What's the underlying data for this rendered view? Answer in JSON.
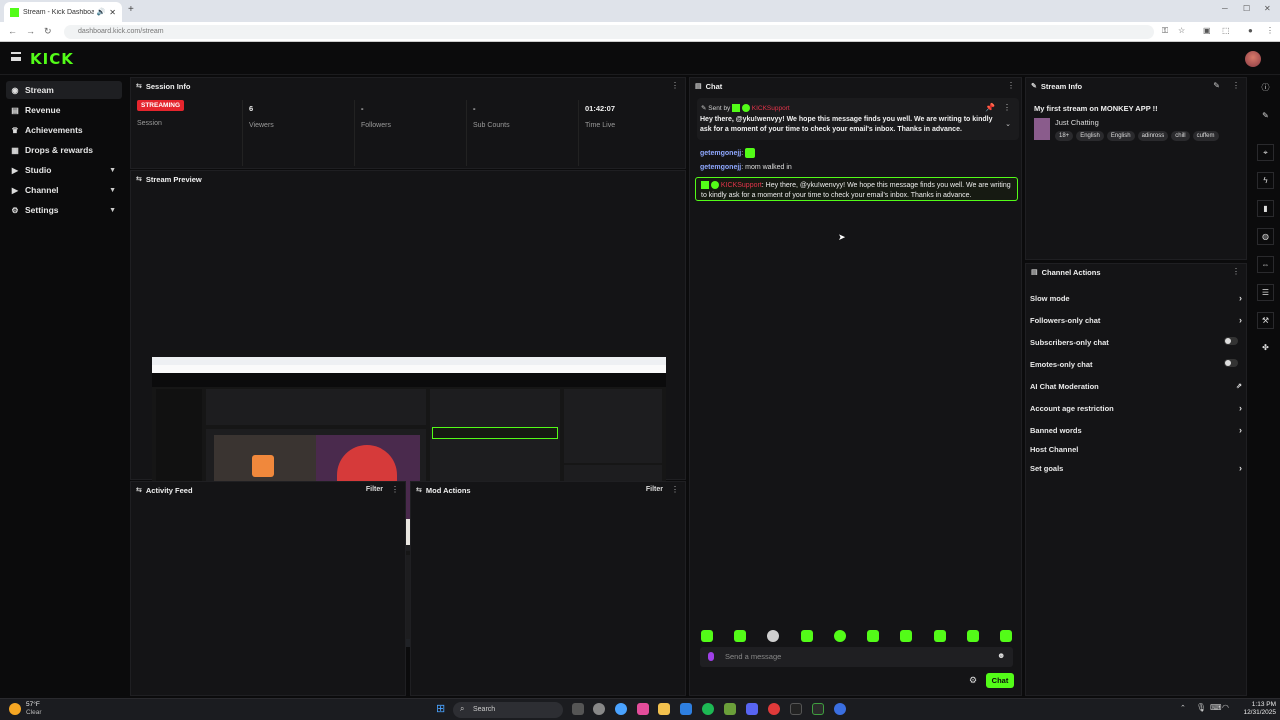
{
  "browser": {
    "tab_title": "Stream - Kick Dashboard",
    "url": "dashboard.kick.com/stream"
  },
  "app": {
    "logo": "KICK"
  },
  "sidebar": {
    "items": [
      {
        "label": "Stream",
        "icon": "broadcast-icon"
      },
      {
        "label": "Revenue",
        "icon": "revenue-icon"
      },
      {
        "label": "Achievements",
        "icon": "trophy-icon"
      },
      {
        "label": "Drops & rewards",
        "icon": "gift-icon"
      },
      {
        "label": "Studio",
        "icon": "studio-icon"
      },
      {
        "label": "Channel",
        "icon": "channel-icon"
      },
      {
        "label": "Settings",
        "icon": "gear-icon"
      }
    ]
  },
  "session_info": {
    "title": "Session Info",
    "status_badge": "STREAMING",
    "session_label": "Session",
    "viewers_value": "6",
    "viewers_label": "Viewers",
    "followers_value": "-",
    "followers_label": "Followers",
    "subs_value": "-",
    "subs_label": "Sub Counts",
    "time_value": "01:42:07",
    "time_label": "Time Live"
  },
  "stream_preview": {
    "title": "Stream Preview"
  },
  "activity_feed": {
    "title": "Activity Feed",
    "filter": "Filter"
  },
  "mod_actions": {
    "title": "Mod Actions",
    "filter": "Filter"
  },
  "chat": {
    "title": "Chat",
    "pinned_header": "Sent by",
    "pinned_user": "KICKSupport",
    "pinned_text": "Hey there, @yku!wenvyy! We hope this message finds you well. We are writing to kindly ask for a moment of your time to check your email's inbox. Thanks in advance.",
    "messages": [
      {
        "user": "getemgonejj",
        "text": ""
      },
      {
        "user": "getemgonejj",
        "text": "mom walked in"
      }
    ],
    "highlighted": {
      "user": "KICKSupport",
      "text": "Hey there, @yku!wenvyy! We hope this message finds you well. We are writing to kindly ask for a moment of your time to check your email's inbox. Thanks in advance."
    },
    "input_placeholder": "Send a message",
    "send_label": "Chat"
  },
  "stream_info": {
    "title": "Stream Info",
    "stream_title": "My first stream on MONKEY APP !!",
    "category": "Just Chatting",
    "tags": [
      "18+",
      "English",
      "English",
      "adinross",
      "chill",
      "cuffem"
    ]
  },
  "channel_actions": {
    "title": "Channel Actions",
    "items": [
      {
        "label": "Slow mode",
        "control": "chevron"
      },
      {
        "label": "Followers-only chat",
        "control": "chevron"
      },
      {
        "label": "Subscribers-only chat",
        "control": "toggle"
      },
      {
        "label": "Emotes-only chat",
        "control": "toggle"
      },
      {
        "label": "AI Chat Moderation",
        "control": "external"
      },
      {
        "label": "Account age restriction",
        "control": "chevron"
      },
      {
        "label": "Banned words",
        "control": "chevron"
      },
      {
        "label": "Host Channel",
        "control": "none"
      },
      {
        "label": "Set goals",
        "control": "chevron"
      }
    ]
  },
  "taskbar": {
    "weather_temp": "57°F",
    "weather_text": "Clear",
    "search_label": "Search",
    "time": "1:13 PM",
    "date": "12/31/2025"
  },
  "colors": {
    "accent": "#53fc18",
    "live": "#e5252d",
    "background": "#0b0b0c"
  }
}
